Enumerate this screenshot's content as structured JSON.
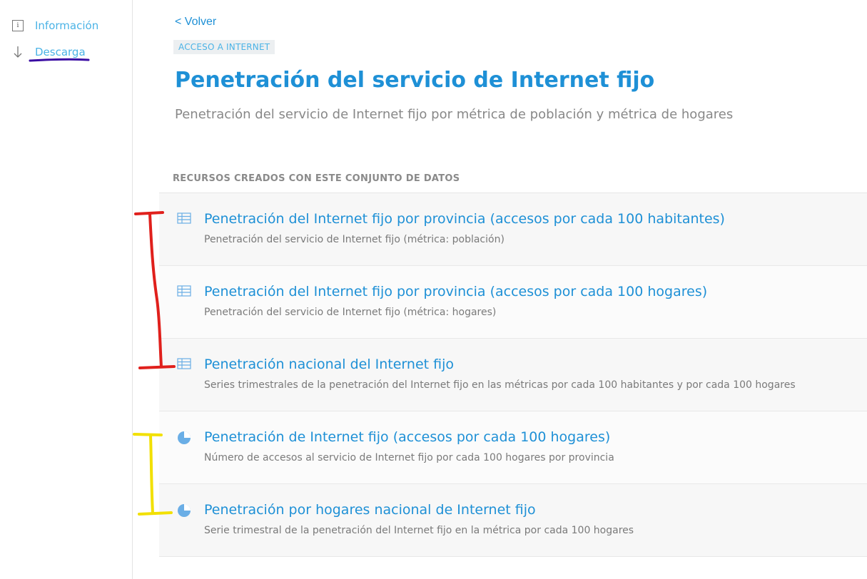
{
  "sidebar": {
    "items": [
      {
        "label": "Información",
        "icon": "info-icon"
      },
      {
        "label": "Descarga",
        "icon": "arrow-down-icon"
      }
    ]
  },
  "header": {
    "back_label": "< Volver",
    "tag": "ACCESO A INTERNET",
    "title": "Penetración del servicio de Internet fijo",
    "subtitle": "Penetración del servicio de Internet fijo por métrica de población y métrica de hogares"
  },
  "resources": {
    "heading": "RECURSOS CREADOS CON ESTE CONJUNTO DE DATOS",
    "items": [
      {
        "icon": "table-icon",
        "title": "Penetración del Internet fijo por provincia (accesos por cada 100 habitantes)",
        "description": "Penetración del servicio de Internet fijo (métrica: población)"
      },
      {
        "icon": "table-icon",
        "title": "Penetración del Internet fijo por provincia (accesos por cada 100 hogares)",
        "description": "Penetración del servicio de Internet fijo (métrica: hogares)"
      },
      {
        "icon": "table-icon",
        "title": "Penetración nacional del Internet fijo",
        "description": "Series trimestrales de la penetración del Internet fijo en las métricas por cada 100 habitantes y por cada 100 hogares"
      },
      {
        "icon": "pie-chart-icon",
        "title": "Penetración de Internet fijo (accesos por cada 100 hogares)",
        "description": "Número de accesos al servicio de Internet fijo por cada 100 hogares por provincia"
      },
      {
        "icon": "pie-chart-icon",
        "title": "Penetración por hogares nacional de Internet fijo",
        "description": "Serie trimestral de la penetración del Internet fijo en la métrica por cada 100 hogares"
      }
    ]
  },
  "colors": {
    "accent": "#1e90d6",
    "link_light": "#4bb3e6",
    "annotation_red": "#e0201c",
    "annotation_yellow": "#f2e000",
    "annotation_purple": "#3a0ca3"
  }
}
